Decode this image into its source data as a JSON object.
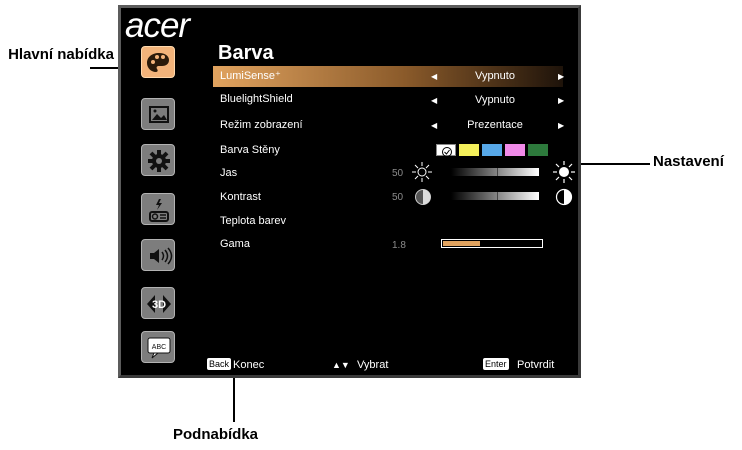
{
  "callouts": {
    "main_menu": "Hlavní nabídka",
    "settings": "Nastavení",
    "submenu": "Podnabídka"
  },
  "osd": {
    "logo": "acer",
    "menu_icons": [
      "palette-icon",
      "image-icon",
      "gear-icon",
      "projector-power-icon",
      "speaker-icon",
      "3d-icon",
      "abc-language-icon"
    ],
    "title": "Barva",
    "rows": [
      {
        "label": "LumiSense⁺",
        "value": "Vypnuto"
      },
      {
        "label": "BluelightShield",
        "value": "Vypnuto"
      },
      {
        "label": "Režim zobrazení",
        "value": "Prezentace"
      },
      {
        "label": "Barva Stěny",
        "value": ""
      },
      {
        "label": "Jas",
        "number": "50"
      },
      {
        "label": "Kontrast",
        "number": "50"
      },
      {
        "label": "Teplota barev",
        "value": ""
      },
      {
        "label": "Gama",
        "number": "1.8"
      }
    ],
    "wall_colors": [
      "#ffffff",
      "#f3ef5a",
      "#57a8e8",
      "#f08ae8",
      "#2d7a3c"
    ],
    "gamma_fill": 0.38,
    "footer": {
      "back_key": "Back",
      "back_label": "Konec",
      "select_glyph": "▲▼",
      "select_label": "Vybrat",
      "enter_key": "Enter",
      "enter_label": "Potvrdit"
    }
  }
}
